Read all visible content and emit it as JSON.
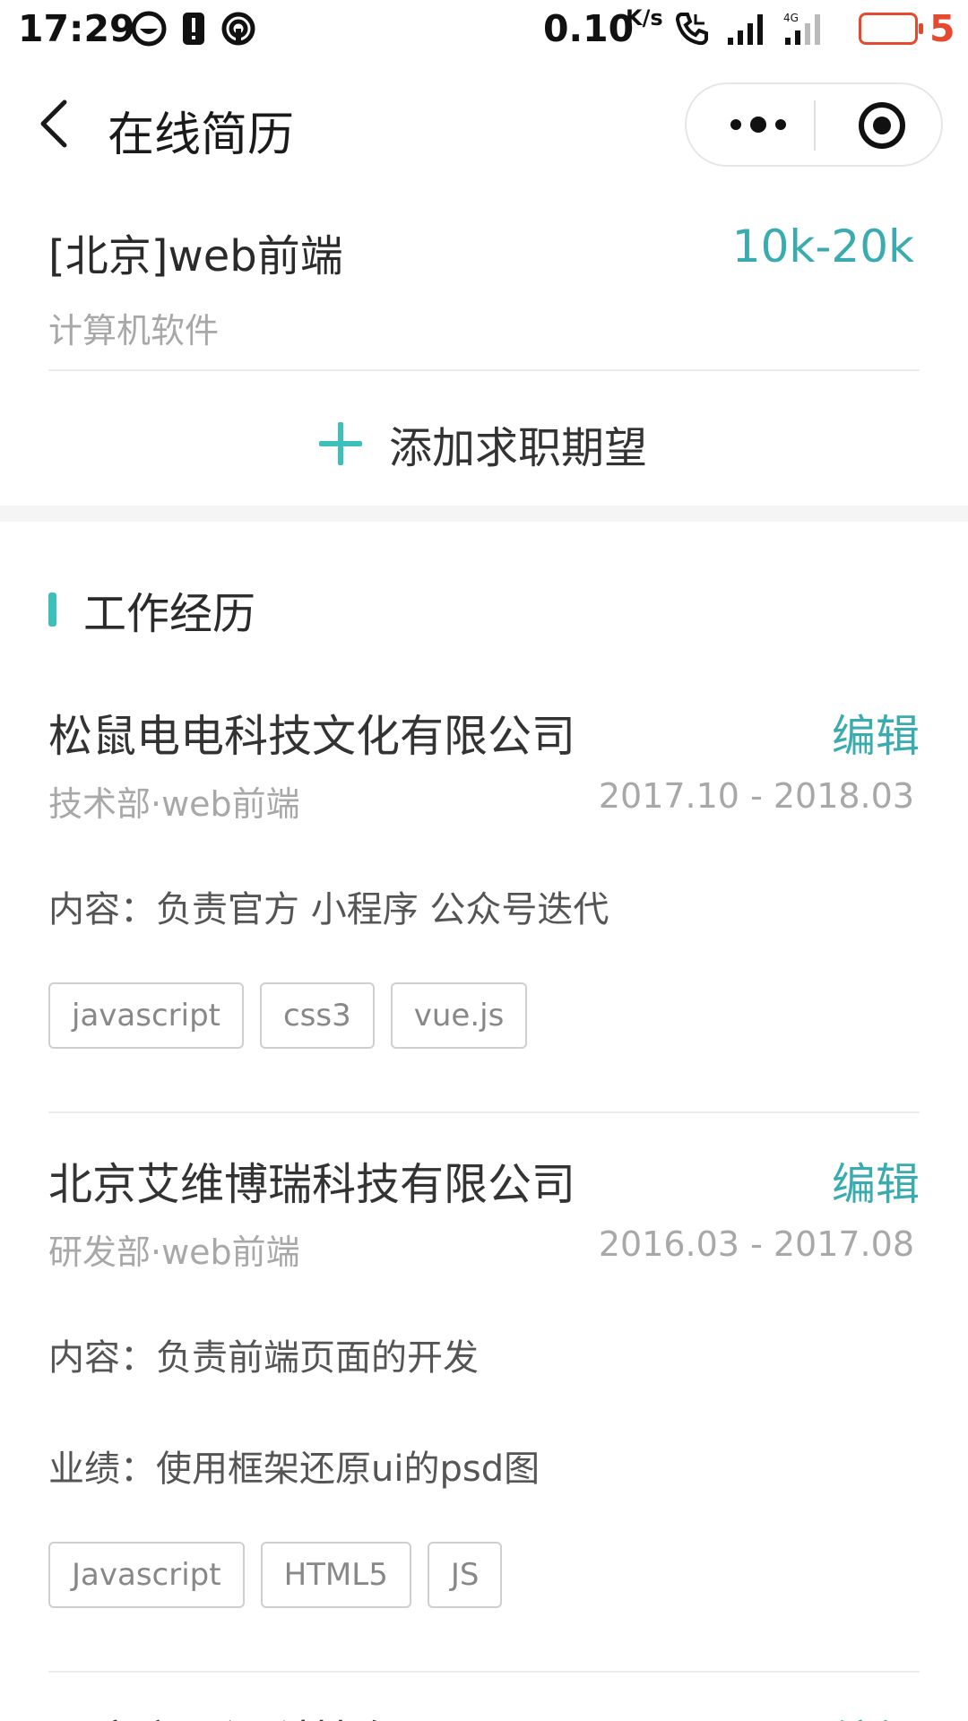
{
  "status_bar": {
    "time": "17:29",
    "net_speed": "0.10",
    "net_speed_unit": "K/s",
    "network_type": "4G",
    "battery_level": "5",
    "battery_color": "#e64a2e"
  },
  "navbar": {
    "title": "在线简历",
    "icons": [
      "back-arrow-icon",
      "more-dots-icon",
      "close-target-icon"
    ]
  },
  "expectation": {
    "title": "[北京]web前端",
    "salary": "10k-20k",
    "industry": "计算机软件",
    "add_label": "添加求职期望"
  },
  "work_section": {
    "title": "工作经历",
    "jobs": [
      {
        "company": "松鼠电电科技文化有限公司",
        "edit_label": "编辑",
        "dept": "技术部·web前端",
        "period": "2017.10 - 2018.03",
        "content": "内容：负责官方 小程序 公众号迭代",
        "tags": [
          "javascript",
          "css3",
          "vue.js"
        ]
      },
      {
        "company": "北京艾维博瑞科技有限公司",
        "edit_label": "编辑",
        "dept": "研发部·web前端",
        "period": "2016.03 - 2017.08",
        "content": "内容：负责前端页面的开发",
        "achievement": "业绩：使用框架还原ui的psd图",
        "tags": [
          "Javascript",
          "HTML5",
          "JS"
        ]
      },
      {
        "company": "百度方正源科技有限公司",
        "edit_label": "编辑"
      }
    ]
  },
  "colors": {
    "accent": "#3aacb0",
    "accent_bar": "#3dbfbc",
    "muted_text": "#a8a8a8"
  }
}
